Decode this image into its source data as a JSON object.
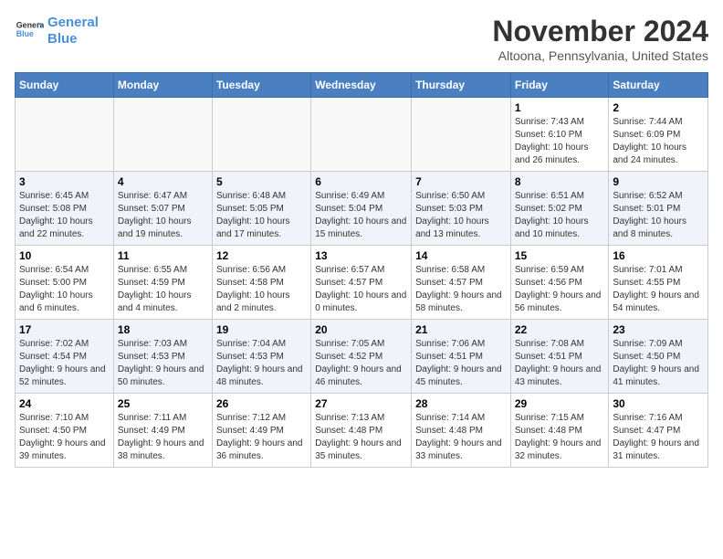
{
  "header": {
    "logo_line1": "General",
    "logo_line2": "Blue",
    "month": "November 2024",
    "location": "Altoona, Pennsylvania, United States"
  },
  "days_of_week": [
    "Sunday",
    "Monday",
    "Tuesday",
    "Wednesday",
    "Thursday",
    "Friday",
    "Saturday"
  ],
  "weeks": [
    [
      {
        "day": "",
        "info": ""
      },
      {
        "day": "",
        "info": ""
      },
      {
        "day": "",
        "info": ""
      },
      {
        "day": "",
        "info": ""
      },
      {
        "day": "",
        "info": ""
      },
      {
        "day": "1",
        "info": "Sunrise: 7:43 AM\nSunset: 6:10 PM\nDaylight: 10 hours and 26 minutes."
      },
      {
        "day": "2",
        "info": "Sunrise: 7:44 AM\nSunset: 6:09 PM\nDaylight: 10 hours and 24 minutes."
      }
    ],
    [
      {
        "day": "3",
        "info": "Sunrise: 6:45 AM\nSunset: 5:08 PM\nDaylight: 10 hours and 22 minutes."
      },
      {
        "day": "4",
        "info": "Sunrise: 6:47 AM\nSunset: 5:07 PM\nDaylight: 10 hours and 19 minutes."
      },
      {
        "day": "5",
        "info": "Sunrise: 6:48 AM\nSunset: 5:05 PM\nDaylight: 10 hours and 17 minutes."
      },
      {
        "day": "6",
        "info": "Sunrise: 6:49 AM\nSunset: 5:04 PM\nDaylight: 10 hours and 15 minutes."
      },
      {
        "day": "7",
        "info": "Sunrise: 6:50 AM\nSunset: 5:03 PM\nDaylight: 10 hours and 13 minutes."
      },
      {
        "day": "8",
        "info": "Sunrise: 6:51 AM\nSunset: 5:02 PM\nDaylight: 10 hours and 10 minutes."
      },
      {
        "day": "9",
        "info": "Sunrise: 6:52 AM\nSunset: 5:01 PM\nDaylight: 10 hours and 8 minutes."
      }
    ],
    [
      {
        "day": "10",
        "info": "Sunrise: 6:54 AM\nSunset: 5:00 PM\nDaylight: 10 hours and 6 minutes."
      },
      {
        "day": "11",
        "info": "Sunrise: 6:55 AM\nSunset: 4:59 PM\nDaylight: 10 hours and 4 minutes."
      },
      {
        "day": "12",
        "info": "Sunrise: 6:56 AM\nSunset: 4:58 PM\nDaylight: 10 hours and 2 minutes."
      },
      {
        "day": "13",
        "info": "Sunrise: 6:57 AM\nSunset: 4:57 PM\nDaylight: 10 hours and 0 minutes."
      },
      {
        "day": "14",
        "info": "Sunrise: 6:58 AM\nSunset: 4:57 PM\nDaylight: 9 hours and 58 minutes."
      },
      {
        "day": "15",
        "info": "Sunrise: 6:59 AM\nSunset: 4:56 PM\nDaylight: 9 hours and 56 minutes."
      },
      {
        "day": "16",
        "info": "Sunrise: 7:01 AM\nSunset: 4:55 PM\nDaylight: 9 hours and 54 minutes."
      }
    ],
    [
      {
        "day": "17",
        "info": "Sunrise: 7:02 AM\nSunset: 4:54 PM\nDaylight: 9 hours and 52 minutes."
      },
      {
        "day": "18",
        "info": "Sunrise: 7:03 AM\nSunset: 4:53 PM\nDaylight: 9 hours and 50 minutes."
      },
      {
        "day": "19",
        "info": "Sunrise: 7:04 AM\nSunset: 4:53 PM\nDaylight: 9 hours and 48 minutes."
      },
      {
        "day": "20",
        "info": "Sunrise: 7:05 AM\nSunset: 4:52 PM\nDaylight: 9 hours and 46 minutes."
      },
      {
        "day": "21",
        "info": "Sunrise: 7:06 AM\nSunset: 4:51 PM\nDaylight: 9 hours and 45 minutes."
      },
      {
        "day": "22",
        "info": "Sunrise: 7:08 AM\nSunset: 4:51 PM\nDaylight: 9 hours and 43 minutes."
      },
      {
        "day": "23",
        "info": "Sunrise: 7:09 AM\nSunset: 4:50 PM\nDaylight: 9 hours and 41 minutes."
      }
    ],
    [
      {
        "day": "24",
        "info": "Sunrise: 7:10 AM\nSunset: 4:50 PM\nDaylight: 9 hours and 39 minutes."
      },
      {
        "day": "25",
        "info": "Sunrise: 7:11 AM\nSunset: 4:49 PM\nDaylight: 9 hours and 38 minutes."
      },
      {
        "day": "26",
        "info": "Sunrise: 7:12 AM\nSunset: 4:49 PM\nDaylight: 9 hours and 36 minutes."
      },
      {
        "day": "27",
        "info": "Sunrise: 7:13 AM\nSunset: 4:48 PM\nDaylight: 9 hours and 35 minutes."
      },
      {
        "day": "28",
        "info": "Sunrise: 7:14 AM\nSunset: 4:48 PM\nDaylight: 9 hours and 33 minutes."
      },
      {
        "day": "29",
        "info": "Sunrise: 7:15 AM\nSunset: 4:48 PM\nDaylight: 9 hours and 32 minutes."
      },
      {
        "day": "30",
        "info": "Sunrise: 7:16 AM\nSunset: 4:47 PM\nDaylight: 9 hours and 31 minutes."
      }
    ]
  ]
}
